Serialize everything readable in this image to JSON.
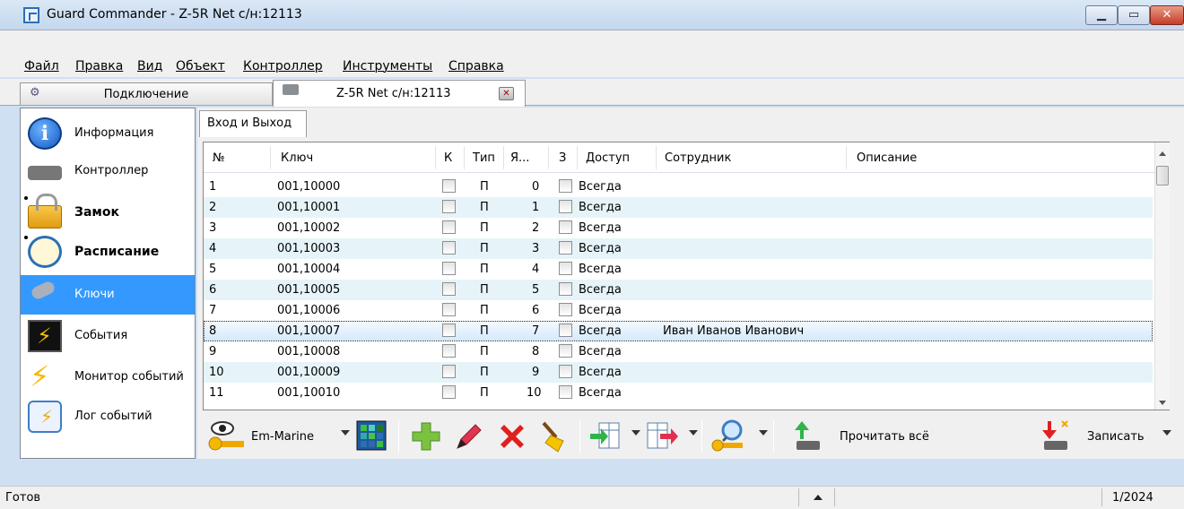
{
  "window": {
    "title": "Guard Commander - Z-5R Net с/н:12113"
  },
  "menu": [
    "Файл",
    "Правка",
    "Вид",
    "Объект",
    "Контроллер",
    "Инструменты",
    "Справка"
  ],
  "tabs": {
    "connection": "Подключение",
    "device": "Z-5R Net с/н:12113"
  },
  "nav": [
    {
      "label": "Информация",
      "icon": "info-icon"
    },
    {
      "label": "Контроллер",
      "icon": "chip-icon"
    },
    {
      "label": "Замок",
      "icon": "lock-icon"
    },
    {
      "label": "Расписание",
      "icon": "clock-icon"
    },
    {
      "label": "Ключи",
      "icon": "keys-icon"
    },
    {
      "label": "События",
      "icon": "events-icon"
    },
    {
      "label": "Монитор событий",
      "icon": "lightning-icon"
    },
    {
      "label": "Лог событий",
      "icon": "log-icon"
    }
  ],
  "subtab": "Вход и Выход",
  "columns": [
    "№",
    "Ключ",
    "К",
    "Тип",
    "Я...",
    "З",
    "Доступ",
    "Сотрудник",
    "Описание"
  ],
  "rows": [
    {
      "num": "1",
      "key": "001,10000",
      "type": "П",
      "ya": "0",
      "access": "Всегда",
      "employee": "",
      "desc": ""
    },
    {
      "num": "2",
      "key": "001,10001",
      "type": "П",
      "ya": "1",
      "access": "Всегда",
      "employee": "",
      "desc": ""
    },
    {
      "num": "3",
      "key": "001,10002",
      "type": "П",
      "ya": "2",
      "access": "Всегда",
      "employee": "",
      "desc": ""
    },
    {
      "num": "4",
      "key": "001,10003",
      "type": "П",
      "ya": "3",
      "access": "Всегда",
      "employee": "",
      "desc": ""
    },
    {
      "num": "5",
      "key": "001,10004",
      "type": "П",
      "ya": "4",
      "access": "Всегда",
      "employee": "",
      "desc": ""
    },
    {
      "num": "6",
      "key": "001,10005",
      "type": "П",
      "ya": "5",
      "access": "Всегда",
      "employee": "",
      "desc": ""
    },
    {
      "num": "7",
      "key": "001,10006",
      "type": "П",
      "ya": "6",
      "access": "Всегда",
      "employee": "",
      "desc": ""
    },
    {
      "num": "8",
      "key": "001,10007",
      "type": "П",
      "ya": "7",
      "access": "Всегда",
      "employee": "Иван Иванов Иванович",
      "desc": ""
    },
    {
      "num": "9",
      "key": "001,10008",
      "type": "П",
      "ya": "8",
      "access": "Всегда",
      "employee": "",
      "desc": ""
    },
    {
      "num": "10",
      "key": "001,10009",
      "type": "П",
      "ya": "9",
      "access": "Всегда",
      "employee": "",
      "desc": ""
    },
    {
      "num": "11",
      "key": "001,10010",
      "type": "П",
      "ya": "10",
      "access": "Всегда",
      "employee": "",
      "desc": ""
    }
  ],
  "toolbar": {
    "format": "Em-Marine",
    "read_all": "Прочитать всё",
    "write": "Записать"
  },
  "status": {
    "text": "Готов",
    "count": "1/2024"
  }
}
